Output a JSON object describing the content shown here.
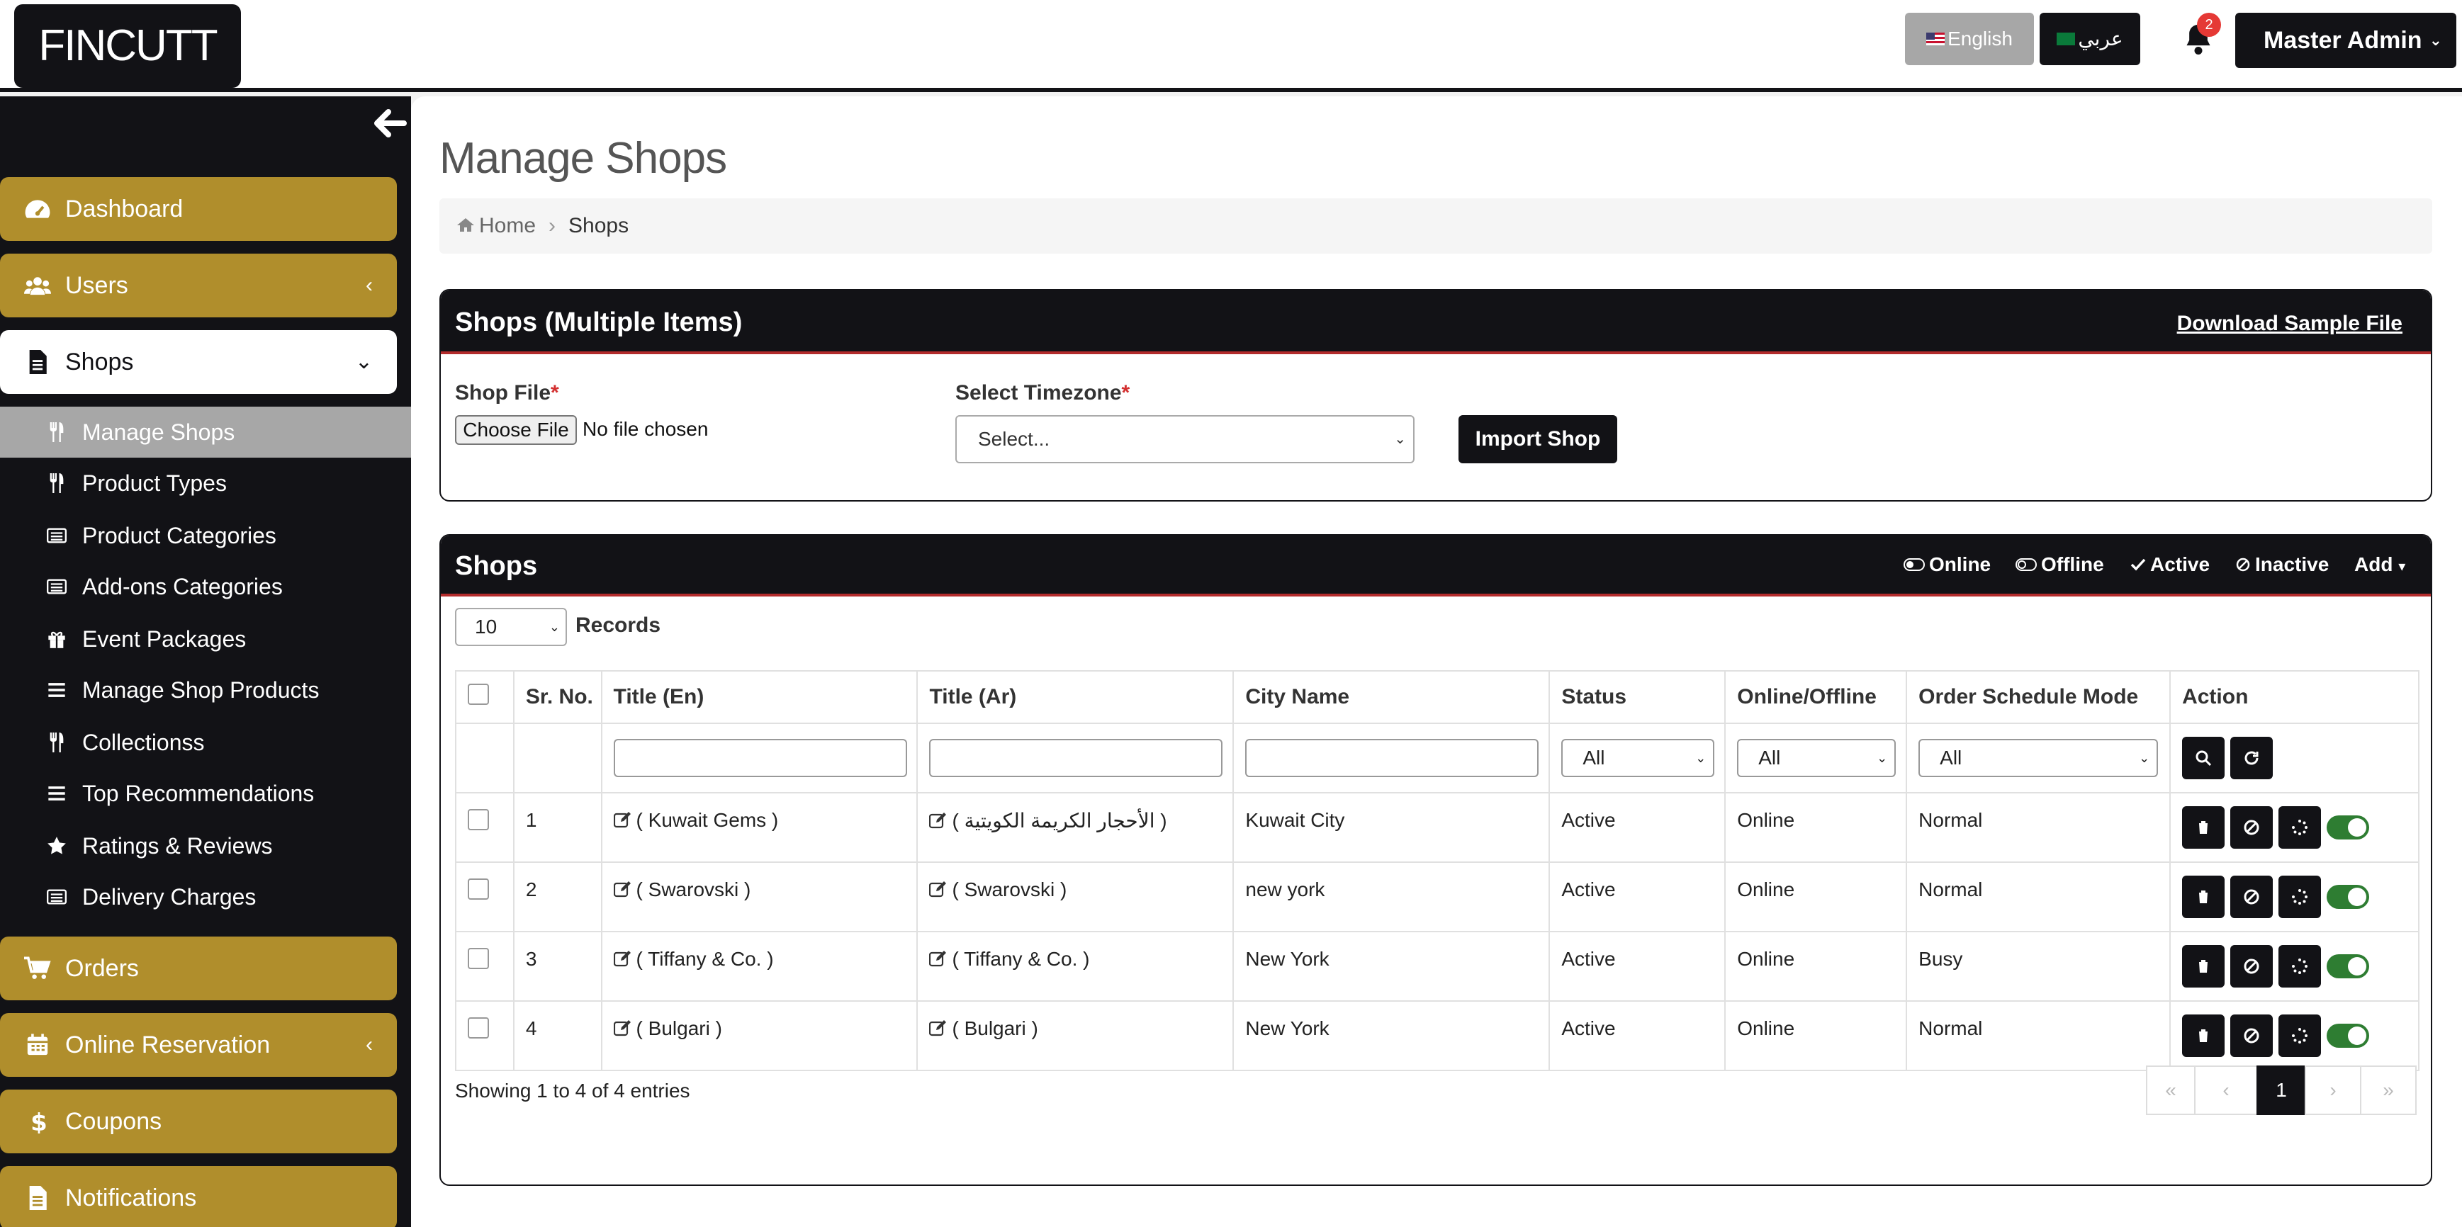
{
  "brand": {
    "logo_text": "FINCUTT"
  },
  "topbar": {
    "lang_en": "English",
    "lang_ar": "عربي",
    "notification_count": "2",
    "admin_label": "Master Admin"
  },
  "sidebar": {
    "main_items": [
      {
        "label": "Dashboard",
        "icon": "dashboard-icon"
      },
      {
        "label": "Users",
        "icon": "users-icon"
      },
      {
        "label": "Shops",
        "icon": "file-icon"
      },
      {
        "label": "Orders",
        "icon": "cart-icon"
      },
      {
        "label": "Online Reservation",
        "icon": "calendar-icon"
      },
      {
        "label": "Coupons",
        "icon": "dollar-icon"
      },
      {
        "label": "Notifications",
        "icon": "file-icon"
      }
    ],
    "sub_items": [
      {
        "label": "Manage Shops",
        "icon": "utensils-icon"
      },
      {
        "label": "Product Types",
        "icon": "utensils-icon"
      },
      {
        "label": "Product Categories",
        "icon": "list-icon"
      },
      {
        "label": "Add-ons Categories",
        "icon": "list-icon"
      },
      {
        "label": "Event Packages",
        "icon": "gift-icon"
      },
      {
        "label": "Manage Shop Products",
        "icon": "bars-icon"
      },
      {
        "label": "Collectionss",
        "icon": "utensils-icon"
      },
      {
        "label": "Top Recommendations",
        "icon": "bars-icon"
      },
      {
        "label": "Ratings & Reviews",
        "icon": "star-icon"
      },
      {
        "label": "Delivery Charges",
        "icon": "list-icon"
      }
    ]
  },
  "page": {
    "title": "Manage Shops",
    "breadcrumb_home": "Home",
    "breadcrumb_current": "Shops"
  },
  "import_panel": {
    "title": "Shops (Multiple Items)",
    "download_link": "Download Sample File",
    "file_label": "Shop File",
    "required_mark": "*",
    "file_button": "Choose File",
    "file_status": "No file chosen",
    "timezone_label": "Select Timezone",
    "timezone_value": "Select...",
    "import_button": "Import Shop"
  },
  "shops_panel": {
    "title": "Shops",
    "legend": {
      "online": "Online",
      "offline": "Offline",
      "active": "Active",
      "inactive": "Inactive",
      "add": "Add"
    },
    "records_value": "10",
    "records_label": "Records",
    "columns": [
      "Sr. No.",
      "Title (En)",
      "Title (Ar)",
      "City Name",
      "Status",
      "Online/Offline",
      "Order Schedule Mode",
      "Action"
    ],
    "filters": {
      "status": "All",
      "online": "All",
      "schedule": "All"
    },
    "rows": [
      {
        "sr": "1",
        "title_en": "( Kuwait Gems )",
        "title_ar": "( الأحجار الكريمة الكويتية )",
        "city": "Kuwait City",
        "status": "Active",
        "online": "Online",
        "mode": "Normal"
      },
      {
        "sr": "2",
        "title_en": "( Swarovski )",
        "title_ar": "( Swarovski )",
        "city": "new york",
        "status": "Active",
        "online": "Online",
        "mode": "Normal"
      },
      {
        "sr": "3",
        "title_en": "( Tiffany & Co. )",
        "title_ar": "( Tiffany & Co. )",
        "city": "New York",
        "status": "Active",
        "online": "Online",
        "mode": "Busy"
      },
      {
        "sr": "4",
        "title_en": "( Bulgari )",
        "title_ar": "( Bulgari )",
        "city": "New York",
        "status": "Active",
        "online": "Online",
        "mode": "Normal"
      }
    ],
    "showing": "Showing 1 to 4 of 4 entries",
    "pagination": {
      "first": "«",
      "prev": "‹",
      "current": "1",
      "next": "›",
      "last": "»"
    }
  },
  "colors": {
    "dark": "#121216",
    "gold": "#b08e2c",
    "gray": "#a7a7a7",
    "toggle_on": "#2e7d32"
  }
}
